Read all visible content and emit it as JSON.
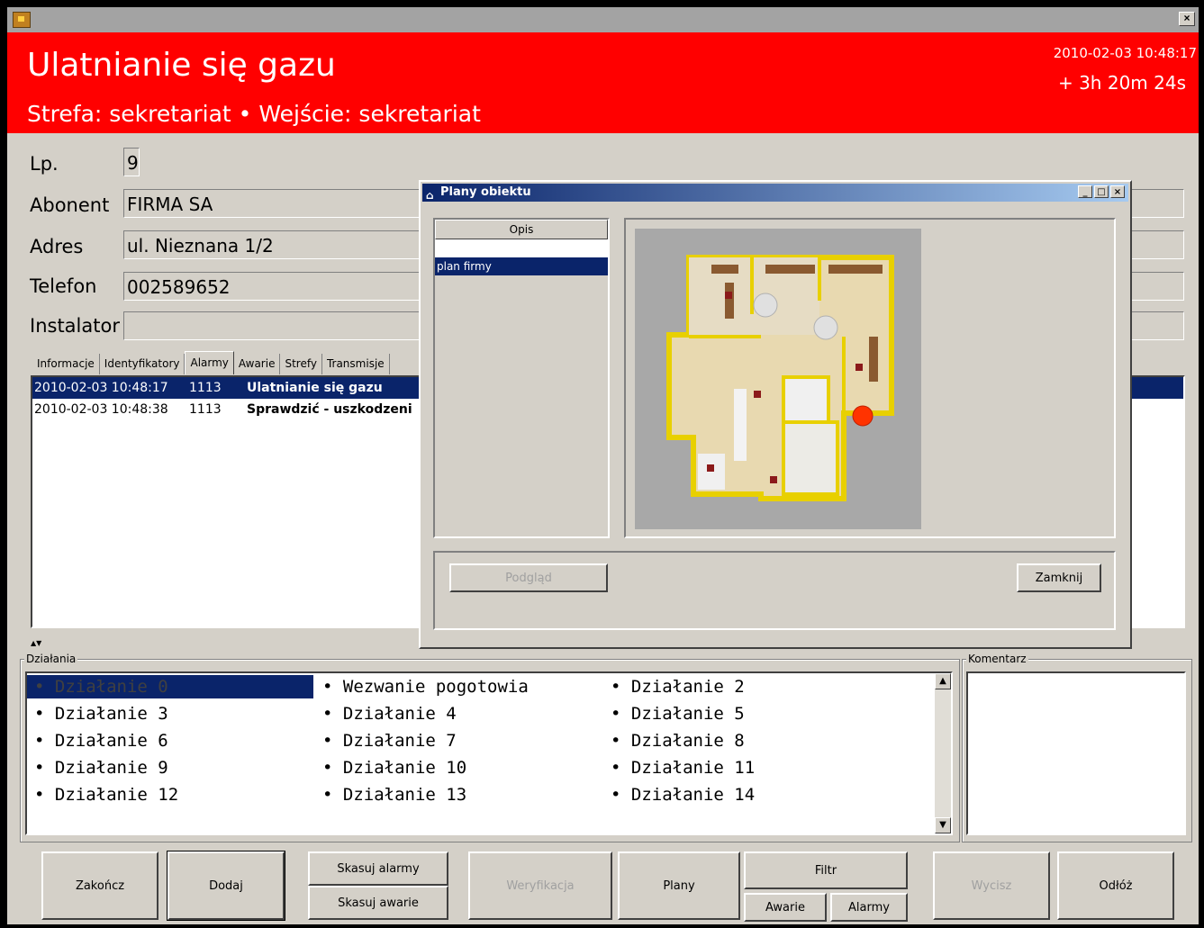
{
  "window": {
    "close_label": "×"
  },
  "alarm": {
    "title": "Ulatnianie się gazu",
    "subtitle": "Strefa: sekretariat • Wejście: sekretariat",
    "datetime": "2010-02-03 10:48:17",
    "elapsed": "+ 3h 20m 24s",
    "header_color": "#ff0000"
  },
  "fields": {
    "lp_label": "Lp.",
    "lp_value": "9",
    "abonent_label": "Abonent",
    "abonent_value": "FIRMA SA",
    "adres_label": "Adres",
    "adres_value": "ul. Nieznana 1/2",
    "telefon_label": "Telefon",
    "telefon_value": "002589652",
    "instalator_label": "Instalator",
    "instalator_value": ""
  },
  "tabs": [
    {
      "label": "Informacje"
    },
    {
      "label": "Identyfikatory"
    },
    {
      "label": "Alarmy"
    },
    {
      "label": "Awarie"
    },
    {
      "label": "Strefy"
    },
    {
      "label": "Transmisje"
    }
  ],
  "alarms": [
    {
      "datetime": "2010-02-03 10:48:17",
      "code": "1113",
      "description": "Ulatnianie się gazu"
    },
    {
      "datetime": "2010-02-03 10:48:38",
      "code": "1113",
      "description": "Sprawdzić - uszkodzeni"
    }
  ],
  "actions": {
    "label": "Działania",
    "items": [
      "• Działanie 0",
      "• Wezwanie pogotowia",
      "• Działanie 2",
      "• Działanie 3",
      "• Działanie 4",
      "• Działanie 5",
      "• Działanie 6",
      "• Działanie 7",
      "• Działanie 8",
      "• Działanie 9",
      "• Działanie 10",
      "• Działanie 11",
      "• Działanie 12",
      "• Działanie 13",
      "• Działanie 14"
    ]
  },
  "comment": {
    "label": "Komentarz",
    "value": ""
  },
  "buttons": {
    "zakoncz": "Zakończ",
    "dodaj": "Dodaj",
    "skasuj_alarmy": "Skasuj alarmy",
    "skasuj_awarie": "Skasuj awarie",
    "weryfikacja": "Weryfikacja",
    "plany": "Plany",
    "filtr": "Filtr",
    "awarie": "Awarie",
    "alarmy": "Alarmy",
    "wycisz": "Wycisz",
    "odloz": "Odłóż"
  },
  "dialog": {
    "title": "Plany obiektu",
    "list_header": "Opis",
    "items": [
      "",
      "plan firmy"
    ],
    "preview_button": "Podgląd",
    "close_button": "Zamknij",
    "minimize": "_",
    "maximize": "□",
    "close": "×"
  }
}
